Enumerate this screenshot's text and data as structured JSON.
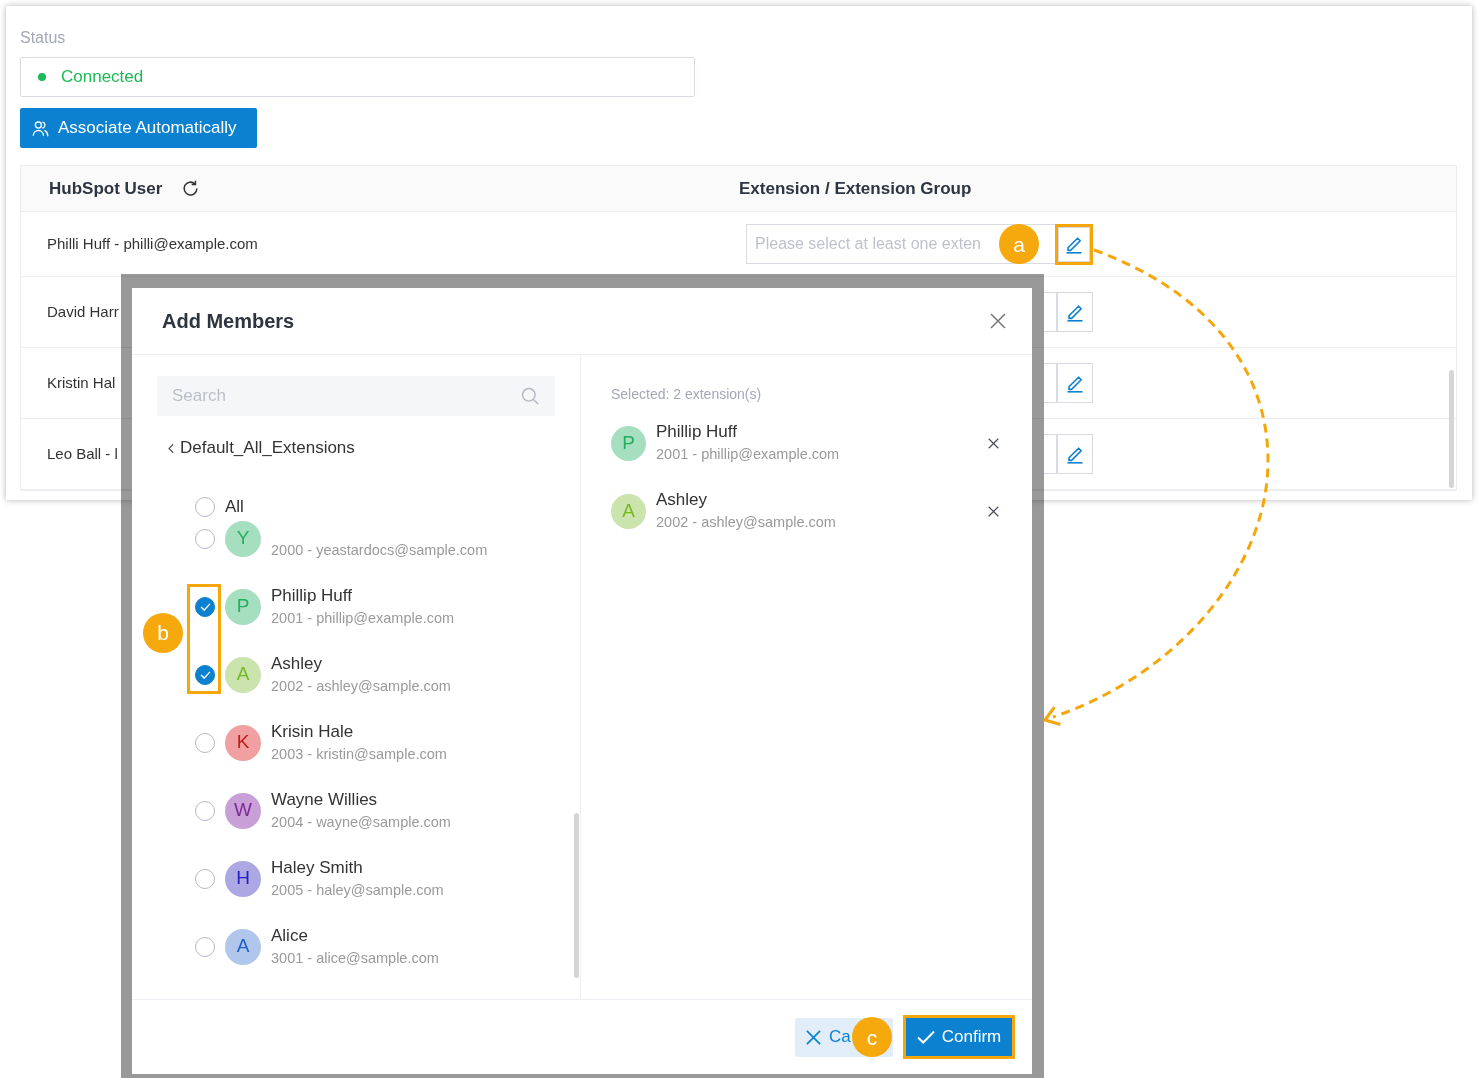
{
  "status": {
    "label": "Status",
    "value": "Connected",
    "connected": true
  },
  "associate_button": {
    "label": "Associate Automatically"
  },
  "table": {
    "columns": [
      "HubSpot User",
      "Extension / Extension Group"
    ],
    "rows": [
      {
        "user": "Philli Huff - philli@example.com",
        "placeholder": "Please select at least one exten",
        "callout": {
          "label": "a",
          "frame": true,
          "arrow": true
        }
      },
      {
        "user": "David Harr"
      },
      {
        "user": "Kristin Hal"
      },
      {
        "user": "Leo Ball - l"
      }
    ]
  },
  "modal": {
    "title": "Add Members",
    "search": {
      "placeholder": "Search"
    },
    "breadcrumb": "Default_All_Extensions",
    "all_option": {
      "label": "All",
      "checked": false
    },
    "members": [
      {
        "initial": "Y",
        "detail": "2000 - yeastardocs@sample.com",
        "color": "#a6dfbf",
        "checked": false
      },
      {
        "initial": "P",
        "name": "Phillip Huff",
        "detail": "2001 - phillip@example.com",
        "color": "#a6dfbf",
        "checked": true
      },
      {
        "initial": "A",
        "name": "Ashley",
        "detail": "2002 - ashley@sample.com",
        "color": "#cbe3ad",
        "checked": true
      },
      {
        "initial": "K",
        "name": "Krisin Hale",
        "detail": "2003 - kristin@sample.com",
        "color": "#f0a0a0",
        "checked": false
      },
      {
        "initial": "W",
        "name": "Wayne Willies",
        "detail": "2004 - wayne@sample.com",
        "color": "#c89fd6",
        "checked": false
      },
      {
        "initial": "H",
        "name": "Haley Smith",
        "detail": "2005 - haley@sample.com",
        "color": "#aba8e4",
        "checked": false
      },
      {
        "initial": "A",
        "name": "Alice",
        "detail": "3001 - alice@sample.com",
        "color": "#b0c6ea",
        "checked": false
      }
    ],
    "members_callout": {
      "label": "b",
      "frame": true
    },
    "selected_summary": "Selected: 2 extension(s)",
    "selected": [
      {
        "initial": "P",
        "name": "Phillip Huff",
        "detail": "2001 - phillip@example.com",
        "color": "#a6dfbf"
      },
      {
        "initial": "A",
        "name": "Ashley",
        "detail": "2002 - ashley@sample.com",
        "color": "#cbe3ad"
      }
    ],
    "buttons": [
      {
        "kind": "cancel",
        "label": "Ca"
      },
      {
        "kind": "confirm",
        "label": "Confirm",
        "callout": {
          "label": "c",
          "frame": true
        }
      }
    ]
  }
}
